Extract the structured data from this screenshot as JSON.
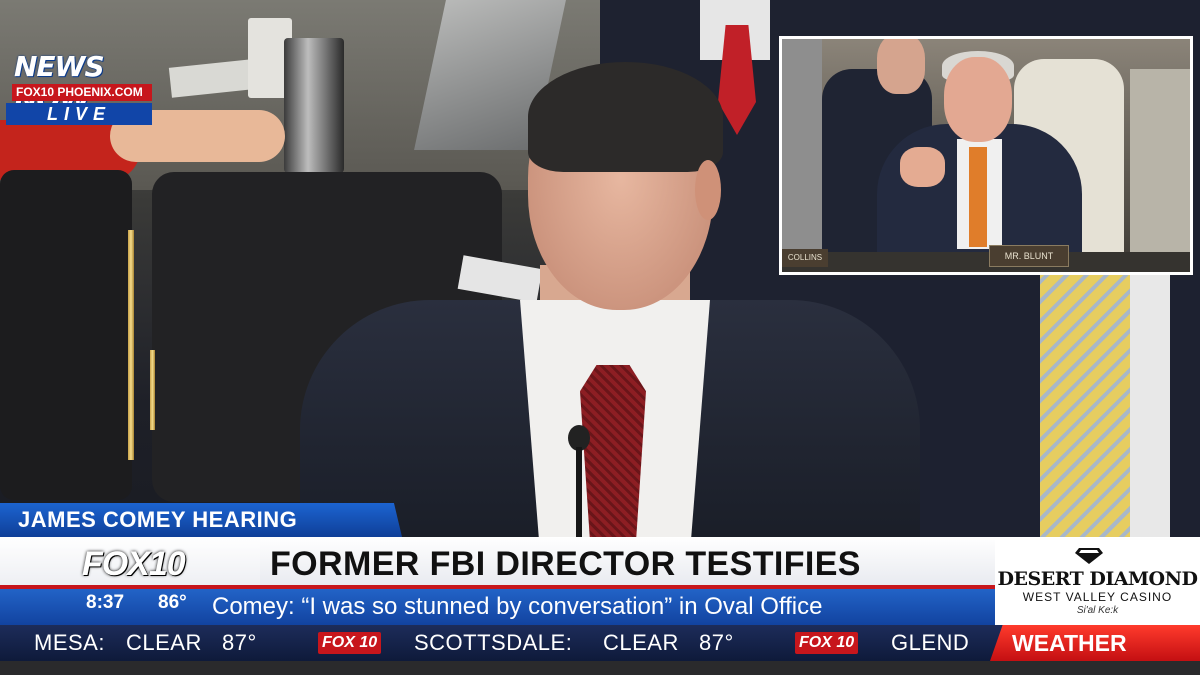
{
  "bug": {
    "news_now": "NEWS NOW",
    "station": "FOX10 PHOENIX.COM",
    "live": "LIVE"
  },
  "inset": {
    "nameplate_main": "MR. BLUNT",
    "nameplate_left": "COLLINS"
  },
  "lower_third": {
    "topic": "JAMES COMEY HEARING",
    "logo": "FOX10",
    "headline": "FORMER FBI DIRECTOR TESTIFIES",
    "time": "8:37",
    "temp": "86°",
    "subline": "Comey: “I was so stunned by conversation” in Oval Office"
  },
  "sponsor": {
    "name": "DESERT DIAMOND",
    "tagline": "WEST VALLEY CASINO",
    "sub": "Si'al Ke:k"
  },
  "ticker": {
    "items": [
      {
        "city": "MESA:",
        "cond": "CLEAR",
        "temp": "87°"
      },
      {
        "city": "SCOTTSDALE:",
        "cond": "CLEAR",
        "temp": "87°"
      },
      {
        "city": "GLEND",
        "cond": "",
        "temp": ""
      }
    ],
    "fox_badge": "FOX 10",
    "weather_label": "WEATHER"
  },
  "colors": {
    "fox_red": "#c7161c",
    "banner_blue": "#1145a8",
    "weather_red": "#ff3b2c"
  }
}
